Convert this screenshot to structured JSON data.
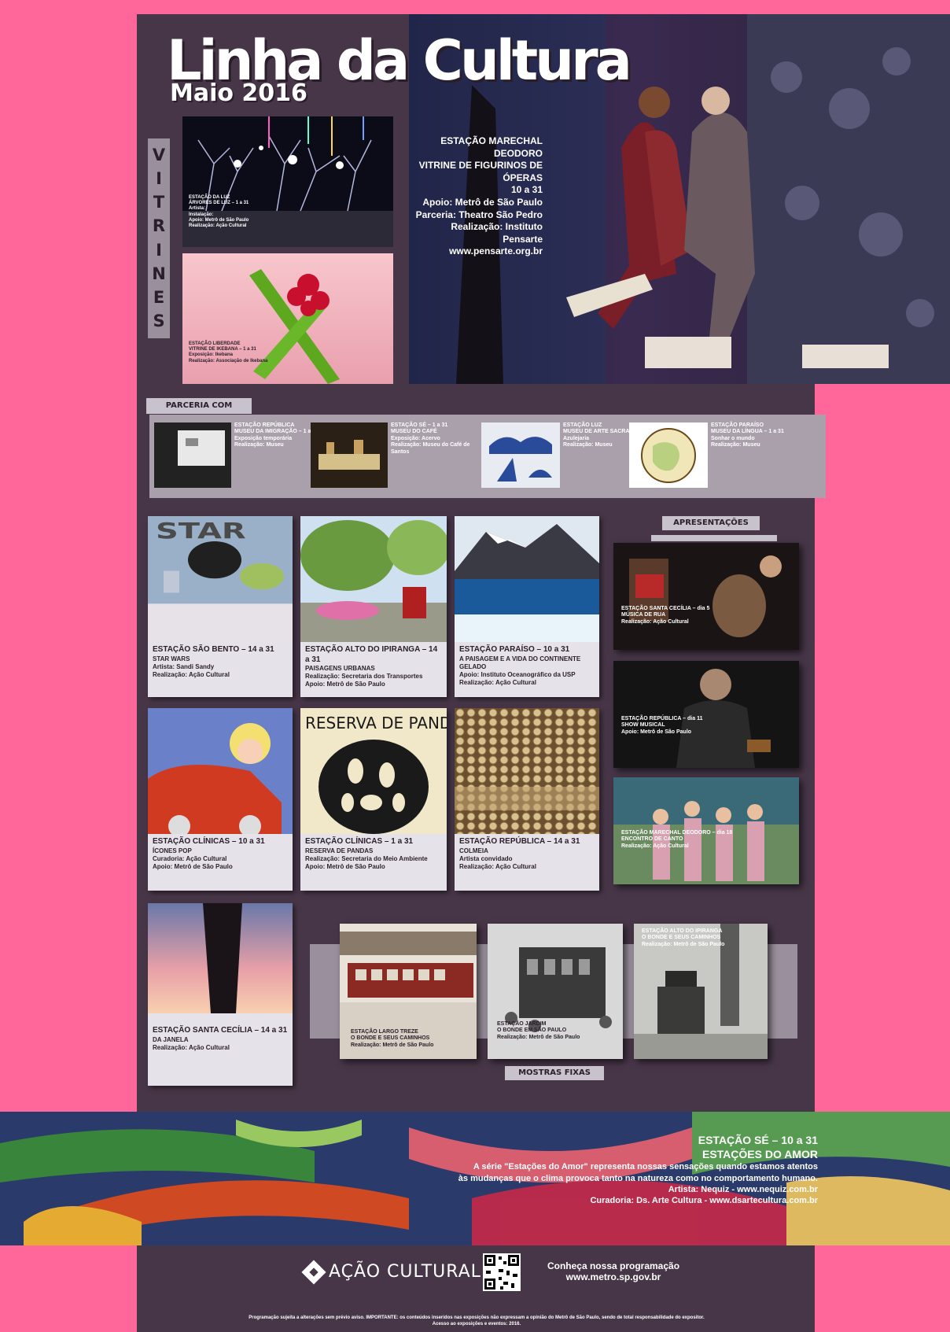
{
  "header": {
    "title": "Linha da Cultura",
    "subtitle": "Maio 2016"
  },
  "vitrines": {
    "letters": [
      "V",
      "I",
      "T",
      "R",
      "I",
      "N",
      "E",
      "S"
    ],
    "item1_caption": [
      "ESTAÇÃO DA LUZ",
      "ÁRVORES DE LUZ – 1 a 31",
      "Artista:",
      "Instalação:",
      "Apoio: Metrô de São Paulo",
      "Realização: Ação Cultural"
    ],
    "item2_caption": [
      "ESTAÇÃO LIBERDADE",
      "VITRINE DE IKEBANA – 1 a 31",
      "Exposição: Ikebana",
      "Realização: Associação de Ikebana"
    ],
    "featured_caption": [
      "ESTAÇÃO MARECHAL DEODORO",
      "VITRINE DE FIGURINOS DE ÓPERAS",
      "10 a 31",
      "Apoio: Metrô de São Paulo",
      "Parceria: Theatro São Pedro",
      "Realização: Instituto Pensarte",
      "www.pensarte.org.br"
    ]
  },
  "parceria": {
    "label": "PARCERIA COM MUSEUS",
    "items": [
      {
        "text": [
          "ESTAÇÃO REPÚBLICA",
          "MUSEU DA IMIGRAÇÃO – 1 a 31",
          "Exposição temporária",
          "Realização: Museu"
        ]
      },
      {
        "text": [
          "ESTAÇÃO SÉ – 1 a 31",
          "MUSEU DO CAFÉ",
          "Exposição: Acervo",
          "Realização: Museu do Café de Santos"
        ]
      },
      {
        "text": [
          "ESTAÇÃO LUZ",
          "MUSEU DE ARTE SACRA – 1 a 31",
          "Azulejaria",
          "Realização: Museu"
        ]
      },
      {
        "text": [
          "ESTAÇÃO PARAÍSO",
          "MUSEU DA LÍNGUA – 1 a 31",
          "Sonhar o mundo",
          "Realização: Museu"
        ]
      }
    ]
  },
  "grid": [
    {
      "heading": "ESTAÇÃO SÃO BENTO – 14 a 31",
      "sub": "STAR WARS",
      "lines": [
        "Artista: Sandi Sandy",
        "Realização: Ação Cultural"
      ]
    },
    {
      "heading": "ESTAÇÃO ALTO DO IPIRANGA – 14 a 31",
      "sub": "PAISAGENS URBANAS",
      "lines": [
        "Realização: Secretaria dos Transportes",
        "Apoio: Metrô de São Paulo"
      ]
    },
    {
      "heading": "ESTAÇÃO PARAÍSO – 10 a 31",
      "sub": "A PAISAGEM E A VIDA DO CONTINENTE GELADO",
      "lines": [
        "Apoio: Instituto Oceanográfico da USP",
        "Realização: Ação Cultural"
      ]
    },
    {
      "heading": "ESTAÇÃO CLÍNICAS – 10 a 31",
      "sub": "ÍCONES POP",
      "lines": [
        "Curadoria: Ação Cultural",
        "Apoio: Metrô de São Paulo"
      ]
    },
    {
      "heading": "ESTAÇÃO CLÍNICAS – 1 a 31",
      "sub": "RESERVA DE PANDAS",
      "lines": [
        "Realização: Secretaria do Meio Ambiente",
        "Apoio: Metrô de São Paulo"
      ]
    },
    {
      "heading": "ESTAÇÃO REPÚBLICA – 14 a 31",
      "sub": "COLMEIA",
      "lines": [
        "Artista convidado",
        "Realização: Ação Cultural"
      ]
    }
  ],
  "apresentacoes": {
    "label": "APRESENTAÇÕES",
    "items": [
      {
        "text": [
          "ESTAÇÃO SANTA CECÍLIA – dia 5",
          "MÚSICA DE RUA",
          "Realização: Ação Cultural"
        ]
      },
      {
        "text": [
          "ESTAÇÃO REPÚBLICA – dia 11",
          "SHOW MUSICAL",
          "Apoio: Metrô de São Paulo"
        ]
      },
      {
        "text": [
          "ESTAÇÃO MARECHAL DEODORO – dia 18",
          "ENCONTRO DE CANTO",
          "Realização: Ação Cultural"
        ]
      }
    ]
  },
  "mostras": {
    "label": "MOSTRAS FIXAS",
    "single": {
      "text": [
        "ESTAÇÃO SANTA CECÍLIA – 14 a 31",
        "DA JANELA",
        "Realização: Ação Cultural"
      ]
    },
    "items": [
      {
        "text": [
          "ESTAÇÃO LARGO TREZE",
          "O BONDE E SEUS CAMINHOS",
          "Realização: Metrô de São Paulo"
        ]
      },
      {
        "text": [
          "ESTAÇÃO JARDIM",
          "O BONDE EM SÃO PAULO",
          "Realização: Metrô de São Paulo"
        ]
      },
      {
        "text": [
          "ESTAÇÃO ALTO DO IPIRANGA",
          "O BONDE E SEUS CAMINHOS",
          "Realização: Metrô de São Paulo"
        ]
      }
    ]
  },
  "banner": {
    "lines": [
      "ESTAÇÃO SÉ – 10 a 31",
      "ESTAÇÕES DO AMOR",
      "A série \"Estações do Amor\" representa nossas sensações quando estamos atentos",
      "às mudanças que o clima provoca tanto na natureza como no comportamento humano.",
      "Artista: Nequiz - www.nequiz.com.br",
      "Curadoria: Ds. Arte Cultura - www.dsartecultura.com.br"
    ]
  },
  "footer": {
    "logo_text": "AÇÃO CULTURAL",
    "cta": "Conheça nossa programação",
    "url": "www.metro.sp.gov.br",
    "disclaimer1": "Programação sujeita a alterações sem prévio aviso. IMPORTANTE: os conteúdos inseridos nas exposições não expressam a opinião do Metrô de São Paulo, sendo de total responsabilidade do expositor.",
    "disclaimer2": "Acesso ao exposições e eventos: 2016."
  }
}
